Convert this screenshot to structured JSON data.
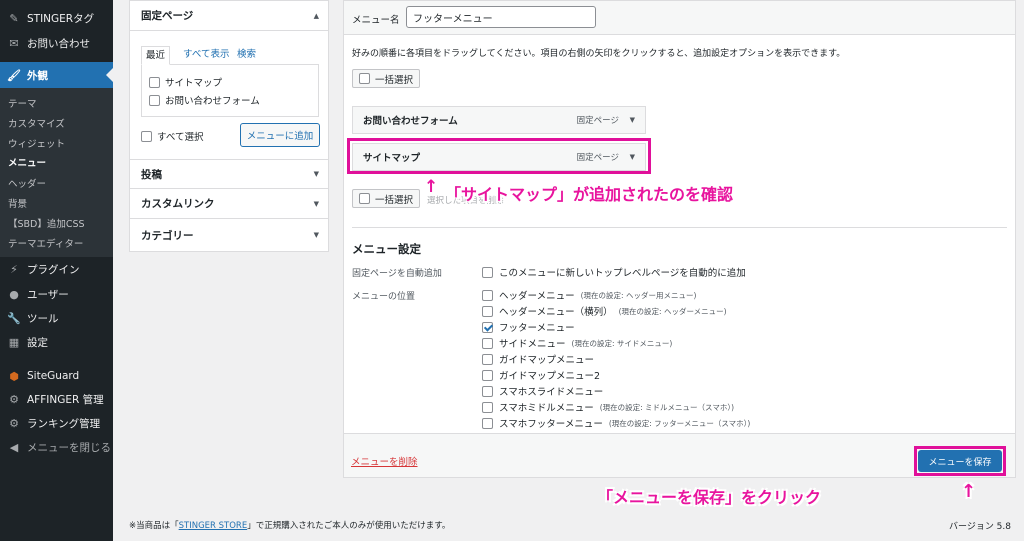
{
  "sidebar": {
    "items": [
      {
        "label": "STINGERタグ",
        "icon": "pin-icon"
      },
      {
        "label": "お問い合わせ",
        "icon": "mail-icon"
      },
      {
        "label": "外観",
        "icon": "brush-icon"
      },
      {
        "label": "プラグイン",
        "icon": "plugin-icon"
      },
      {
        "label": "ユーザー",
        "icon": "user-icon"
      },
      {
        "label": "ツール",
        "icon": "wrench-icon"
      },
      {
        "label": "設定",
        "icon": "settings-icon"
      },
      {
        "label": "SiteGuard",
        "icon": "shield-icon"
      },
      {
        "label": "AFFINGER 管理",
        "icon": "gear-icon"
      },
      {
        "label": "ランキング管理",
        "icon": "gear-icon"
      },
      {
        "label": "メニューを閉じる",
        "icon": "collapse-icon"
      }
    ],
    "submenu": [
      "テーマ",
      "カスタマイズ",
      "ウィジェット",
      "メニュー",
      "ヘッダー",
      "背景",
      "【SBD】追加CSS",
      "テーマエディター"
    ]
  },
  "left_col": {
    "fixed_pages_title": "固定ページ",
    "tabs": [
      "最近",
      "すべて表示",
      "検索"
    ],
    "pages": [
      "サイトマップ",
      "お問い合わせフォーム"
    ],
    "select_all": "すべて選択",
    "add_button": "メニューに追加",
    "sections": [
      "投稿",
      "カスタムリンク",
      "カテゴリー"
    ]
  },
  "main": {
    "menu_name_label": "メニュー名",
    "menu_name_value": "フッターメニュー",
    "instructions": "好みの順番に各項目をドラッグしてください。項目の右側の矢印をクリックすると、追加設定オプションを表示できます。",
    "bulk_select": "一括選択",
    "bulk_remove_hint": "選択した項目を削除",
    "menu_items": [
      {
        "label": "お問い合わせフォーム",
        "type": "固定ページ"
      },
      {
        "label": "サイトマップ",
        "type": "固定ページ"
      }
    ],
    "settings_title": "メニュー設定",
    "auto_add_label": "固定ページを自動追加",
    "auto_add_option": "このメニューに新しいトップレベルページを自動的に追加",
    "locations_label": "メニューの位置",
    "locations": [
      {
        "label": "ヘッダーメニュー",
        "note": "(現在の設定: ヘッダー用メニュー)",
        "checked": false
      },
      {
        "label": "ヘッダーメニュー（横列）",
        "note": "(現在の設定: ヘッダーメニュー)",
        "checked": false
      },
      {
        "label": "フッターメニュー",
        "note": "",
        "checked": true
      },
      {
        "label": "サイドメニュー",
        "note": "(現在の設定: サイドメニュー)",
        "checked": false
      },
      {
        "label": "ガイドマップメニュー",
        "note": "",
        "checked": false
      },
      {
        "label": "ガイドマップメニュー2",
        "note": "",
        "checked": false
      },
      {
        "label": "スマホスライドメニュー",
        "note": "",
        "checked": false
      },
      {
        "label": "スマホミドルメニュー",
        "note": "(現在の設定: ミドルメニュー（スマホ）)",
        "checked": false
      },
      {
        "label": "スマホフッターメニュー",
        "note": "(現在の設定: フッターメニュー（スマホ）)",
        "checked": false
      }
    ],
    "delete_link": "メニューを削除",
    "save_button": "メニューを保存"
  },
  "annotations": {
    "confirm_text": "「サイトマップ」が追加されたのを確認",
    "click_text": "「メニューを保存」をクリック",
    "arrow": "↑",
    "color": "#e8149e"
  },
  "footer": {
    "notice_prefix": "※当商品は「",
    "notice_link": "STINGER STORE",
    "notice_suffix": "」で正規購入されたご本人のみが使用いただけます。",
    "version": "バージョン 5.8"
  },
  "colors": {
    "accent": "#2271b1",
    "sidebar_bg": "#1d2327",
    "highlight": "#e0109a"
  }
}
